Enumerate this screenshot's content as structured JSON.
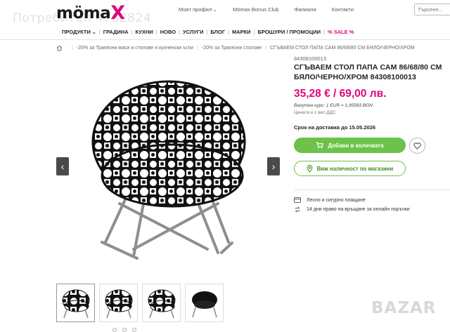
{
  "header": {
    "logo_text": "möma",
    "logo_x": "X",
    "links": [
      "Моят профил",
      "Mömax Bonus Club",
      "Филиали",
      "Контакти"
    ],
    "search_placeholder": "Търсене...",
    "watermark": "Потребител 4782824"
  },
  "nav": {
    "items": [
      "ПРОДУКТИ",
      "ГРАДИНА",
      "КУХНИ",
      "НОВО",
      "УСЛУГИ",
      "БЛОГ",
      "МАРКИ",
      "БРОШУРИ / ПРОМОЦИИ",
      "% SALE %"
    ]
  },
  "breadcrumb": {
    "items": [
      "-20% за Трапезни маси и столове и кухненски ъгли",
      "-20% за Трапезни столове",
      "СГЪВАЕМ СТОЛ ПАПА САМ 86/68/80 СМ БЯЛО/ЧЕРНО/ХРОМ"
    ]
  },
  "product": {
    "sku": "84308100013",
    "title": "СГЪВАЕМ СТОЛ ПАПА САМ 86/68/80 СМ БЯЛО/ЧЕРНО/ХРОМ 84308100013",
    "price": "35,28 € / 69,00 лв.",
    "rate": "Валутен курс: 1 EUR = 1.95583 BGN",
    "vat": "Цената е с вкл.ДДС",
    "delivery": "Срок на доставка до 15.05.2026",
    "add_to_cart": "Добави в количката",
    "store_availability": "Виж наличност по магазини",
    "features": [
      "Лесно и сигурно плащане",
      "14 дни право на връщане за онлайн поръчки"
    ]
  },
  "gallery": {
    "thumbnail_count": 4
  },
  "site_watermark": "BAZAR",
  "colors": {
    "brand_pink": "#e0077d",
    "green": "#6cc24a"
  }
}
